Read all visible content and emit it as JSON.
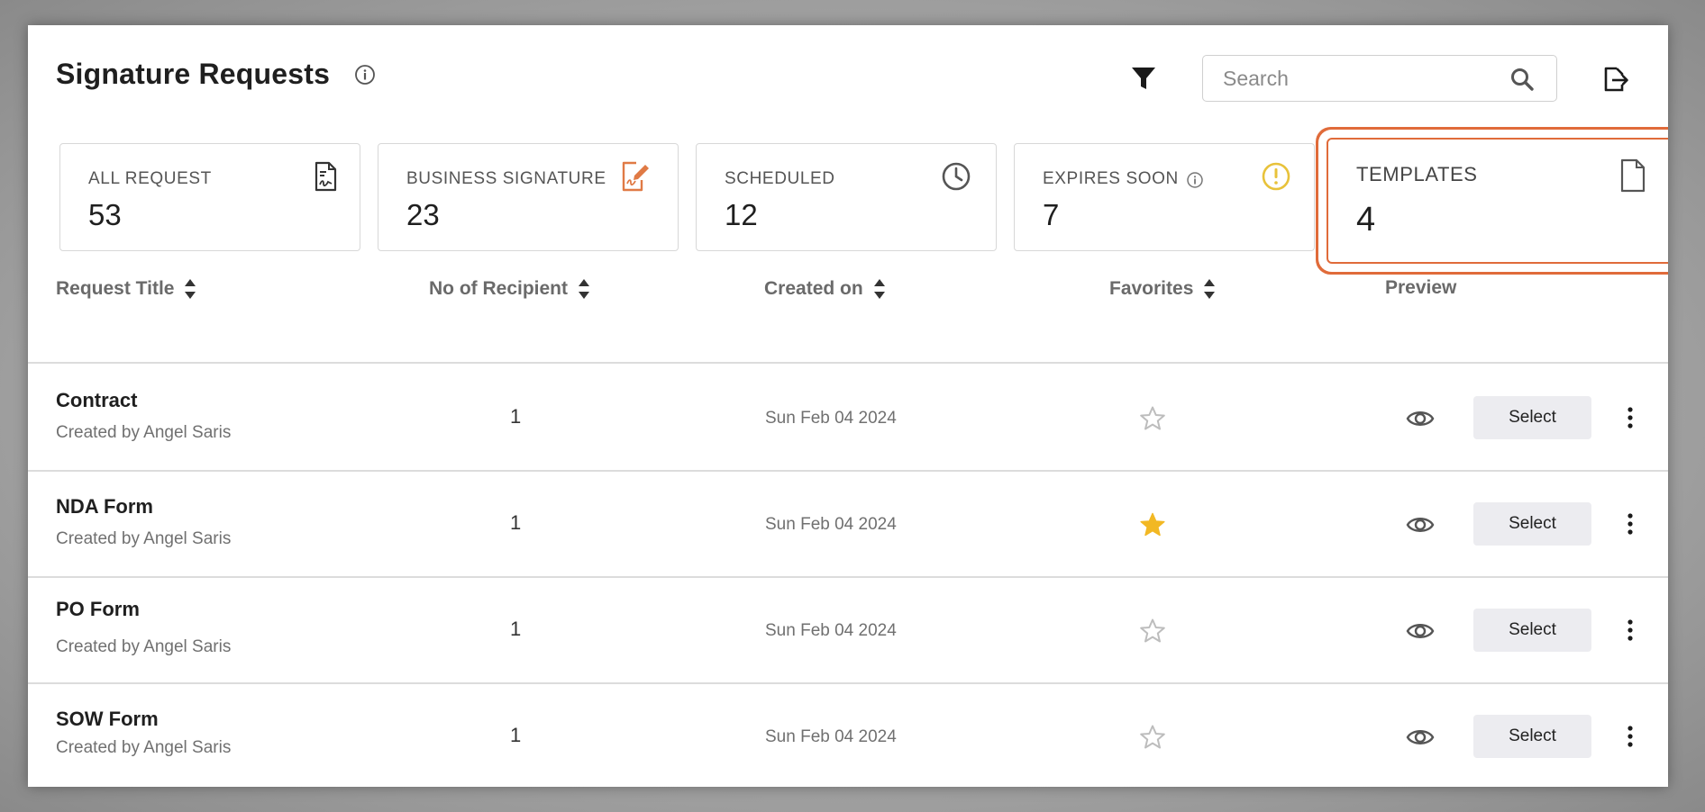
{
  "header": {
    "title": "Signature Requests",
    "search_placeholder": "Search"
  },
  "cards": [
    {
      "label": "ALL REQUEST",
      "value": "53",
      "icon": "document-signature-icon"
    },
    {
      "label": "BUSINESS SIGNATURE",
      "value": "23",
      "icon": "edit-signature-icon",
      "icon_color": "#e07a45"
    },
    {
      "label": "SCHEDULED",
      "value": "12",
      "icon": "clock-icon"
    },
    {
      "label": "EXPIRES SOON",
      "value": "7",
      "icon": "warning-icon",
      "icon_color": "#e8c23a"
    },
    {
      "label": "TEMPLATES",
      "value": "4",
      "icon": "file-icon",
      "highlight_color": "#e06b3a"
    }
  ],
  "table": {
    "columns": [
      "Request Title",
      "No of Recipient",
      "Created on",
      "Favorites",
      "Preview"
    ],
    "rows": [
      {
        "title": "Contract",
        "created_by": "Created by Angel Saris",
        "recipients": "1",
        "created_on": "Sun Feb 04 2024",
        "favorite": false,
        "action": "Select"
      },
      {
        "title": "NDA Form",
        "created_by": "Created by Angel Saris",
        "recipients": "1",
        "created_on": "Sun Feb 04 2024",
        "favorite": true,
        "action": "Select"
      },
      {
        "title": "PO Form",
        "created_by": "Created by Angel Saris",
        "recipients": "1",
        "created_on": "Sun Feb 04 2024",
        "favorite": false,
        "action": "Select"
      },
      {
        "title": "SOW Form",
        "created_by": "Created by Angel Saris",
        "recipients": "1",
        "created_on": "Sun Feb 04 2024",
        "favorite": false,
        "action": "Select"
      }
    ]
  },
  "colors": {
    "star_filled": "#f2b824",
    "star_empty": "#bdbdbd"
  }
}
